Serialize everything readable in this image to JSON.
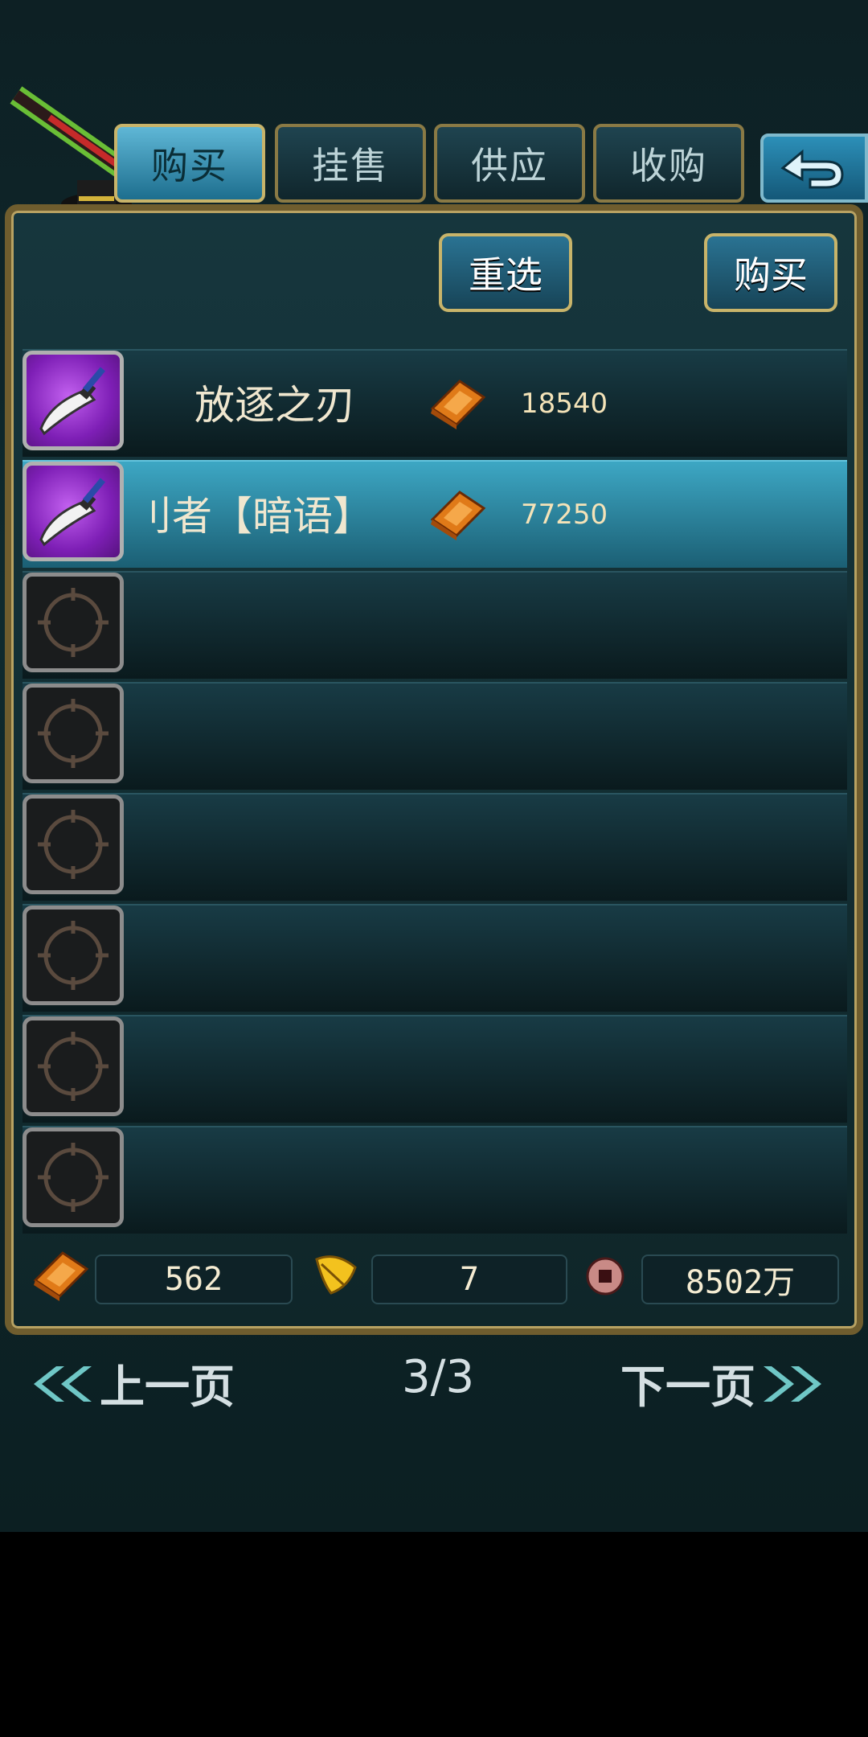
{
  "tabs": [
    {
      "label": "购买",
      "active": true
    },
    {
      "label": "挂售",
      "active": false
    },
    {
      "label": "供应",
      "active": false
    },
    {
      "label": "收购",
      "active": false
    }
  ],
  "back_icon": "return-arrow-icon",
  "actions": {
    "reselect_label": "重选",
    "buy_label": "购买"
  },
  "listings": [
    {
      "name": "放逐之刃",
      "price": "18540",
      "icon": "blade-icon",
      "currency_icon": "gold-ingot-icon",
      "selected": false
    },
    {
      "name": "刂者【暗语】",
      "price": "77250",
      "icon": "blade-icon",
      "currency_icon": "gold-ingot-icon",
      "selected": true
    }
  ],
  "empty_slots": 6,
  "currencies": {
    "gold": "562",
    "leaf": "7",
    "coin": "8502万"
  },
  "pagination": {
    "prev_label": "上一页",
    "page": "3/3",
    "next_label": "下一页"
  },
  "colors": {
    "accent": "#3da7c4",
    "frame_gold": "#b8a262",
    "price_text": "#f4e3b8"
  }
}
